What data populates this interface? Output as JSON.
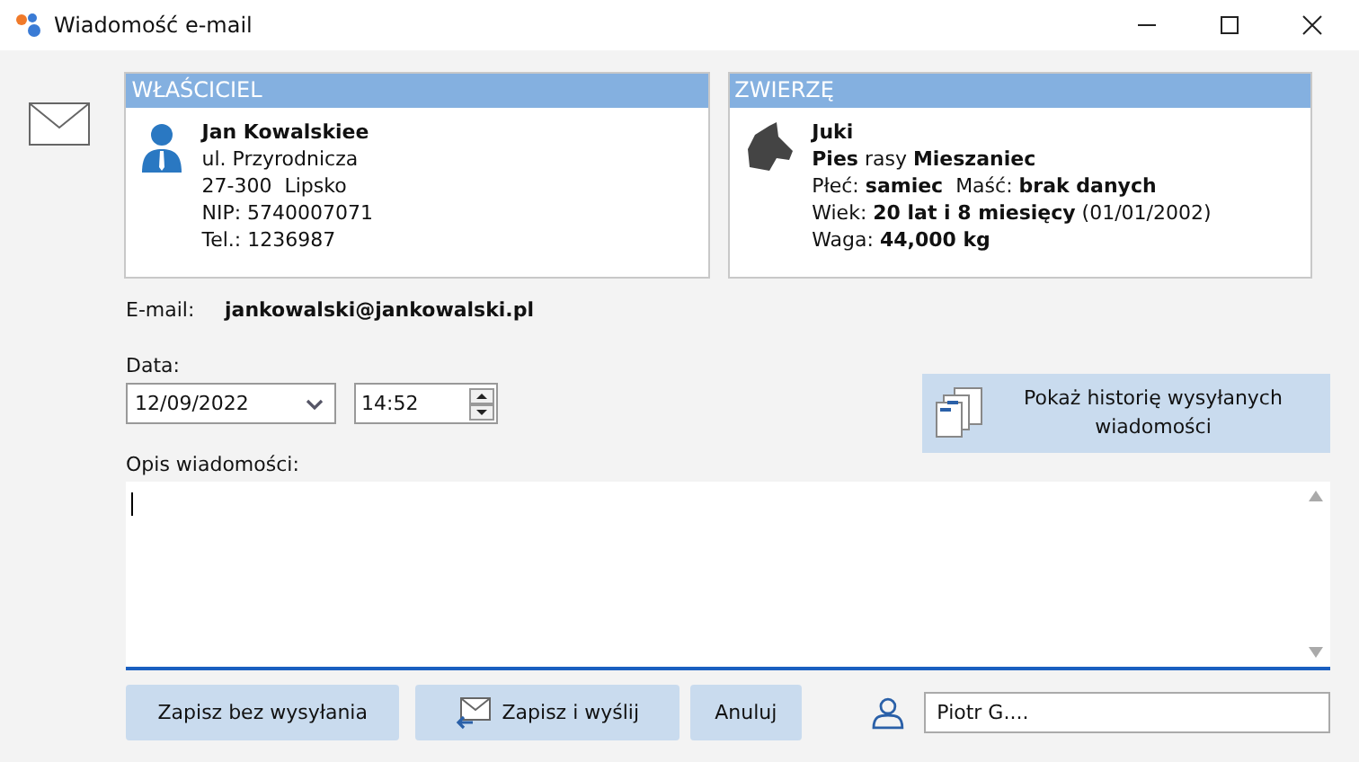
{
  "window": {
    "title": "Wiadomość e-mail"
  },
  "owner": {
    "header": "WŁAŚCICIEL",
    "name": "Jan Kowalskiee",
    "lines": [
      "ul. Przyrodnicza",
      "27-300  Lipsko",
      "NIP: 5740007071",
      "Tel.: 1236987"
    ]
  },
  "pet": {
    "header": "ZWIERZĘ",
    "name": "Juki",
    "lines": [
      "**Pies** rasy **Mieszaniec**",
      "Płeć: **samiec**  Maść: **brak danych**",
      "Wiek: **20 lat i 8 miesięcy** (01/01/2002)",
      "Waga: **44,000 kg**"
    ]
  },
  "email": {
    "label": "E-mail:",
    "value": "jankowalski@jankowalski.pl"
  },
  "date": {
    "label": "Data:",
    "value": "12/09/2022",
    "time": "14:52"
  },
  "history_button": "Pokaż historię wysyłanych wiadomości",
  "message": {
    "label": "Opis wiadomości:"
  },
  "buttons": [
    {
      "label": "Zapisz bez wysyłania",
      "kind": "plain"
    },
    {
      "label": "Zapisz i wyślij",
      "kind": "send"
    },
    {
      "label": "Anuluj",
      "kind": "plain"
    }
  ],
  "user": {
    "value": "Piotr G...."
  }
}
